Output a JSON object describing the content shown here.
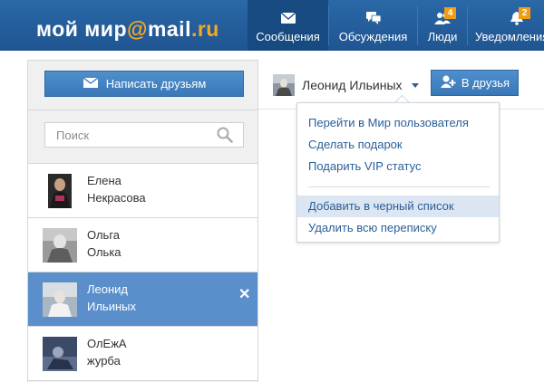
{
  "header": {
    "logo_main": "мой мир",
    "logo_at": "@",
    "logo_mail": "mail",
    "logo_dot": ".",
    "logo_ru": "ru",
    "nav": [
      {
        "label": "Сообщения",
        "icon": "envelope-icon",
        "active": true
      },
      {
        "label": "Обсуждения",
        "icon": "chat-bubbles-icon",
        "active": false
      },
      {
        "label": "Люди",
        "icon": "people-icon",
        "badge": "4",
        "active": false
      },
      {
        "label": "Уведомления",
        "icon": "bell-icon",
        "badge": "2",
        "active": false
      }
    ]
  },
  "sidebar": {
    "write_button": "Написать друзьям",
    "search_placeholder": "Поиск",
    "contacts": [
      {
        "first": "Елена",
        "last": "Некрасова",
        "selected": false
      },
      {
        "first": "Ольга",
        "last": "Олька",
        "selected": false
      },
      {
        "first": "Леонид",
        "last": "Ильиных",
        "selected": true
      },
      {
        "first": "ОлЕжА",
        "last": "журба",
        "selected": false
      }
    ]
  },
  "conversation": {
    "user_name": "Леонид Ильиных",
    "add_friend_button": "В друзья"
  },
  "menu": {
    "items": [
      "Перейти в Мир пользователя",
      "Сделать подарок",
      "Подарить VIP статус",
      "Добавить в черный список",
      "Удалить всю переписку"
    ],
    "highlighted_index": 3
  },
  "colors": {
    "header_bg": "#2a68a7",
    "accent_orange": "#f9a823",
    "selected_row": "#5a8fcb",
    "link": "#2a5f98"
  }
}
